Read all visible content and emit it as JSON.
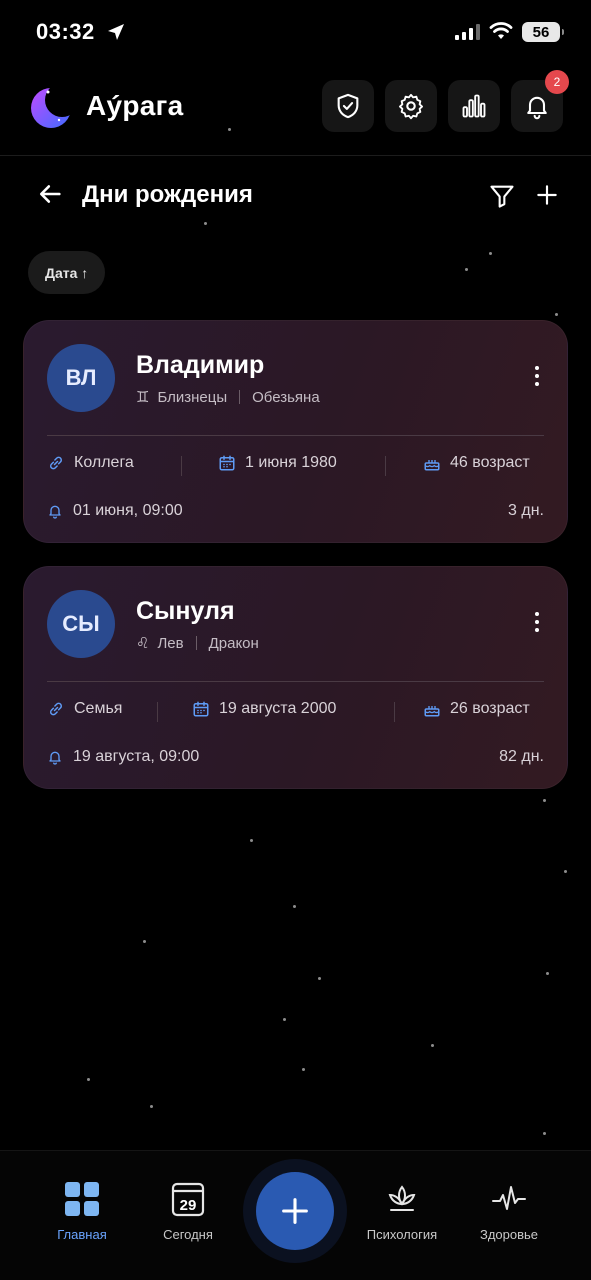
{
  "status_bar": {
    "time": "03:32",
    "battery": "56"
  },
  "app": {
    "brand": "Аýрага",
    "notifications_count": "2"
  },
  "page": {
    "title": "Дни рождения"
  },
  "sort": {
    "label": "Дата ↑"
  },
  "cards": [
    {
      "initials": "ВЛ",
      "name": "Владимир",
      "zodiac": "Близнецы",
      "zodiac_symbol": "♊",
      "animal": "Обезьяна",
      "relation": "Коллега",
      "birthdate": "1 июня 1980",
      "age": "46 возраст",
      "reminder": "01 июня, 09:00",
      "days_left": "3 дн."
    },
    {
      "initials": "СЫ",
      "name": "Сынуля",
      "zodiac": "Лев",
      "zodiac_symbol": "♌",
      "animal": "Дракон",
      "relation": "Семья",
      "birthdate": "19 августа 2000",
      "age": "26 возраст",
      "reminder": "19 августа, 09:00",
      "days_left": "82 дн."
    }
  ],
  "nav": {
    "home": "Главная",
    "today": "Сегодня",
    "today_day": "29",
    "psychology": "Психология",
    "health": "Здоровье"
  },
  "colors": {
    "accent": "#2a5ab2",
    "active_nav": "#6aa4ff",
    "badge": "#e5484d"
  }
}
